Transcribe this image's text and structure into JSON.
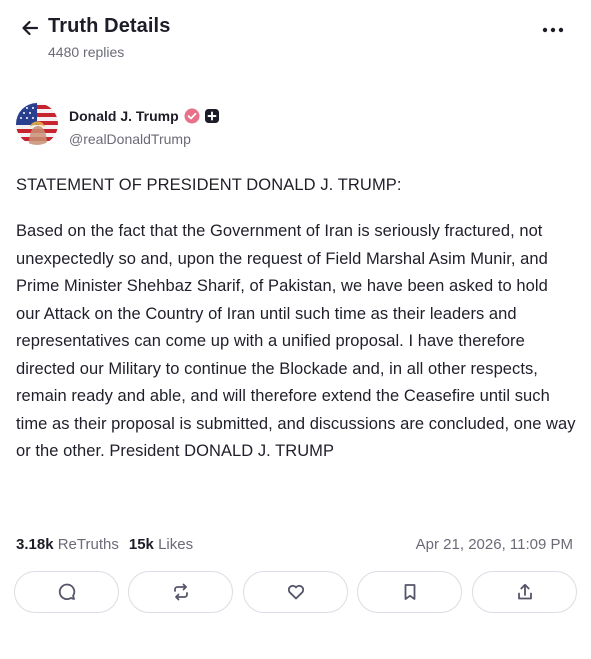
{
  "header": {
    "title": "Truth Details",
    "subtitle": "4480 replies"
  },
  "post": {
    "author_name": "Donald J. Trump",
    "handle": "@realDonaldTrump",
    "heading": "STATEMENT OF PRESIDENT DONALD J. TRUMP:",
    "body": "Based on the fact that the Government of Iran is seriously fractured, not unexpectedly so and, upon the request of Field Marshal Asim Munir, and Prime Minister Shehbaz Sharif, of Pakistan, we have been asked to hold our Attack on the Country of Iran until such time as their leaders and representatives can come up with a unified proposal. I have therefore directed our Military to continue the Blockade and, in all other respects, remain ready and able, and will therefore extend the Ceasefire until such time as their proposal is submitted, and discussions are concluded, one way or the other. President DONALD J. TRUMP",
    "retruths_count": "3.18k",
    "retruths_label": "ReTruths",
    "likes_count": "15k",
    "likes_label": "Likes",
    "timestamp": "Apr 21, 2026, 11:09 PM"
  },
  "icons": {
    "back": "arrow-left-icon",
    "more": "more-horizontal-icon",
    "verified": "verified-badge-icon",
    "plus": "plus-badge-icon",
    "reply": "comment-icon",
    "retruth": "repost-icon",
    "like": "heart-icon",
    "bookmark": "bookmark-icon",
    "share": "share-icon"
  },
  "colors": {
    "text": "#1f1f2a",
    "muted": "#6b6b78",
    "verified": "#e8718a",
    "border": "#dcdce4"
  }
}
